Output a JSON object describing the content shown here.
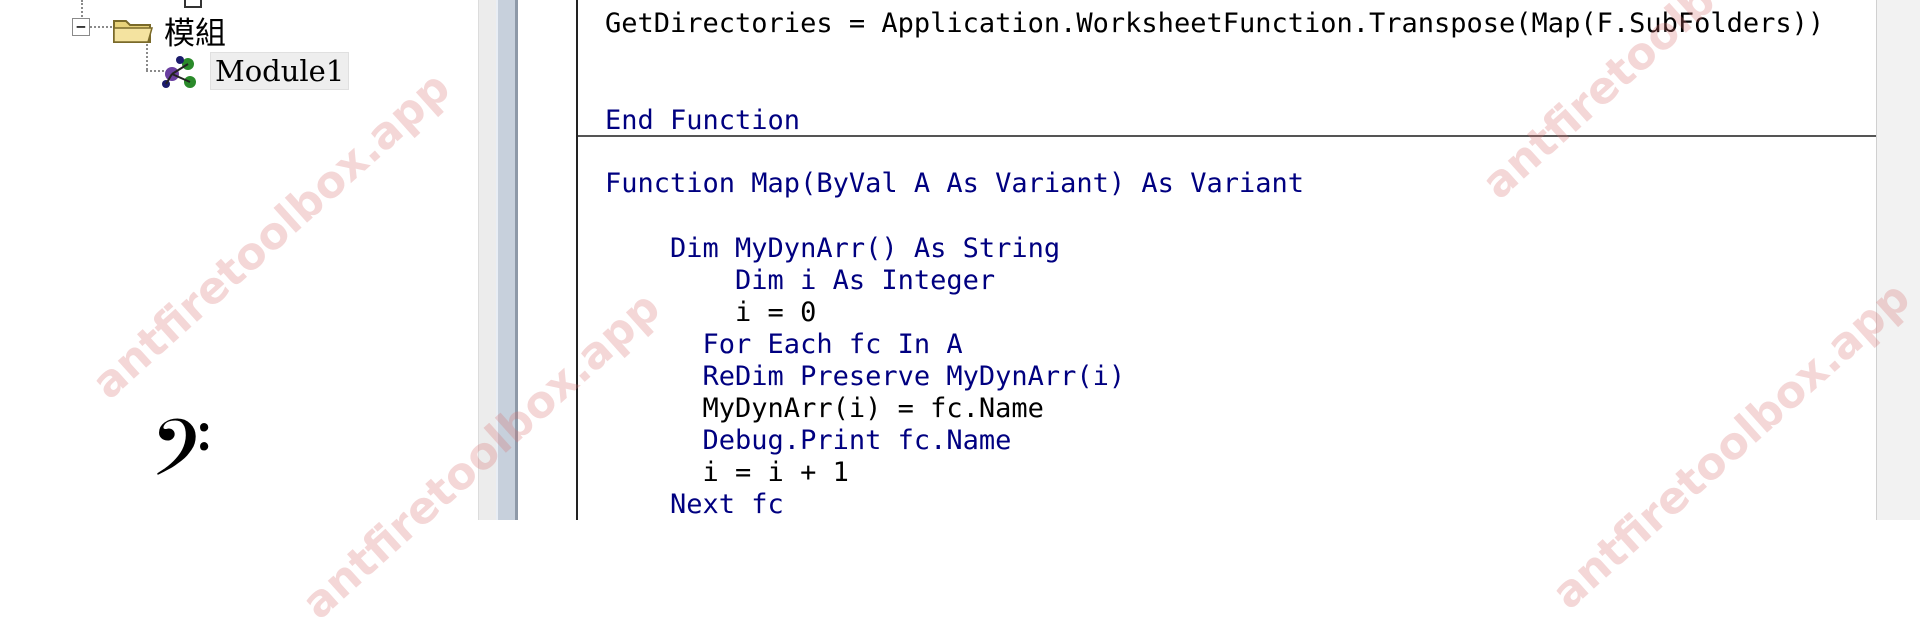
{
  "project_tree": {
    "modules_folder": {
      "label": "模組",
      "expander": "−"
    },
    "module1": {
      "label": "Module1"
    }
  },
  "code_window": {
    "lines_top": [
      "GetDirectories = Application.WorksheetFunction.Transpose(Map(F.SubFolders))",
      "End Function"
    ],
    "lines_bottom": [
      "Function Map(ByVal A As Variant) As Variant",
      "    Dim MyDynArr() As String",
      "        Dim i As Integer",
      "        i = 0",
      "      For Each fc In A",
      "      ReDim Preserve MyDynArr(i)",
      "      MyDynArr(i) = fc.Name",
      "      Debug.Print fc.Name",
      "      i = i + 1",
      "    Next fc"
    ]
  },
  "watermark": {
    "text": "antfiretoolbox.app"
  },
  "icons": {
    "folder": "folder-icon",
    "module": "module-icon",
    "bass_clef": "𝄢"
  },
  "colors": {
    "keyword_blue": "#000080",
    "watermark": "#d66e6e",
    "splitter": "#c7d0dc"
  }
}
